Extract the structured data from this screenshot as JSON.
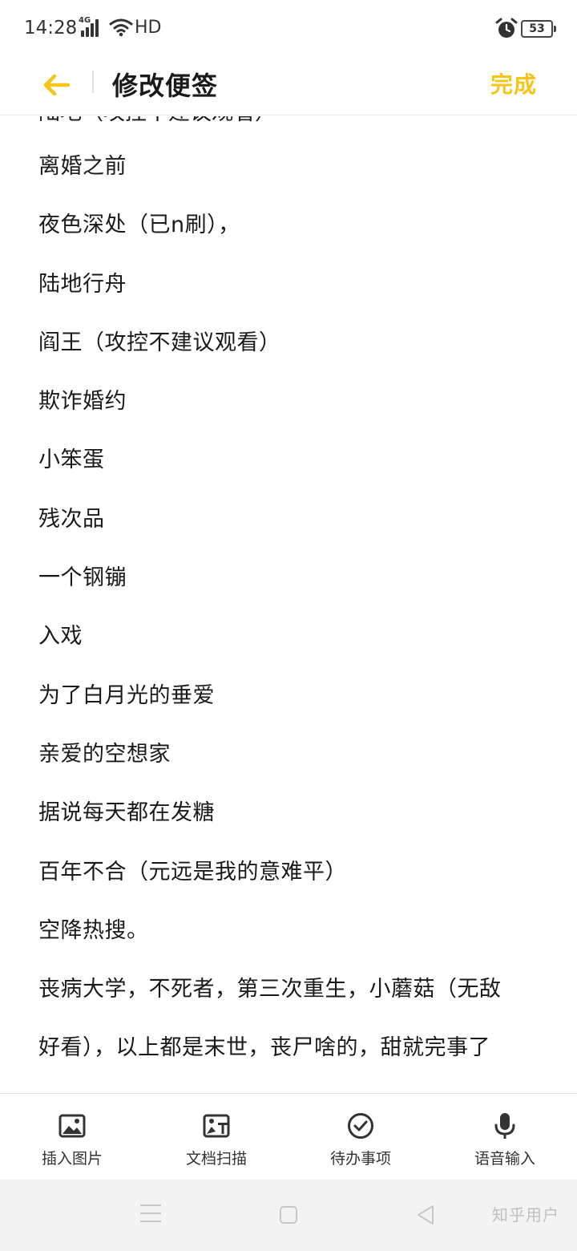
{
  "status_bar": {
    "time": "14:28",
    "network": "4G",
    "hd": "HD",
    "battery": "53",
    "icons": [
      "signal-icon",
      "wifi-icon",
      "alarm-icon",
      "battery-icon"
    ]
  },
  "header": {
    "back_icon": "arrow-left-icon",
    "title": "修改便签",
    "done_label": "完成",
    "accent_color": "#f5c518"
  },
  "note": {
    "clipped_top_line": "陆地（攻控不建议观看）",
    "lines": [
      "离婚之前",
      "夜色深处（已n刷），",
      "陆地行舟",
      "阎王（攻控不建议观看）",
      "欺诈婚约",
      "小笨蛋",
      "残次品",
      "一个钢镚",
      "入戏",
      "为了白月光的垂爱",
      "亲爱的空想家",
      "据说每天都在发糖",
      "百年不合（元远是我的意难平）",
      "空降热搜。",
      "丧病大学，不死者，第三次重生，小蘑菇（无敌",
      "好看），以上都是末世，丧尸啥的，甜就完事了"
    ]
  },
  "toolbar": {
    "items": [
      {
        "label": "插入图片",
        "icon": "image-icon"
      },
      {
        "label": "文档扫描",
        "icon": "scan-icon"
      },
      {
        "label": "待办事项",
        "icon": "checkmark-circle-icon"
      },
      {
        "label": "语音输入",
        "icon": "microphone-icon"
      }
    ]
  },
  "nav_bar": {
    "watermark": "知乎用户"
  }
}
